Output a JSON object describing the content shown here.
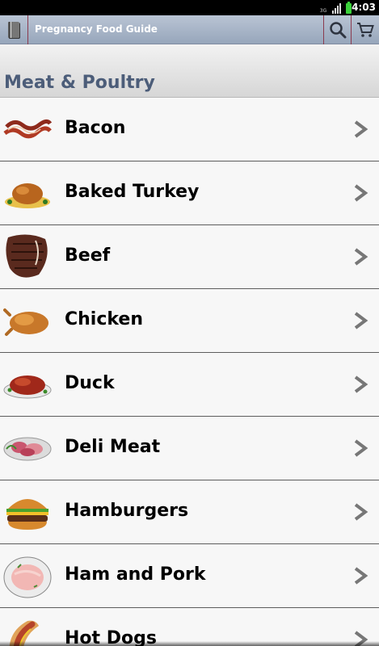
{
  "status_bar": {
    "network": "3G",
    "time": "4:03"
  },
  "action_bar": {
    "title": "Pregnancy Food Guide",
    "icons": [
      "book-icon",
      "search-icon",
      "cart-icon"
    ]
  },
  "section": {
    "title": "Meat & Poultry"
  },
  "items": [
    {
      "label": "Bacon",
      "icon": "bacon-icon"
    },
    {
      "label": "Baked Turkey",
      "icon": "turkey-icon"
    },
    {
      "label": "Beef",
      "icon": "beef-icon"
    },
    {
      "label": "Chicken",
      "icon": "chicken-icon"
    },
    {
      "label": "Duck",
      "icon": "duck-icon"
    },
    {
      "label": "Deli Meat",
      "icon": "deli-meat-icon"
    },
    {
      "label": "Hamburgers",
      "icon": "hamburger-icon"
    },
    {
      "label": "Ham and Pork",
      "icon": "ham-icon"
    },
    {
      "label": "Hot Dogs",
      "icon": "hot-dog-icon"
    }
  ]
}
